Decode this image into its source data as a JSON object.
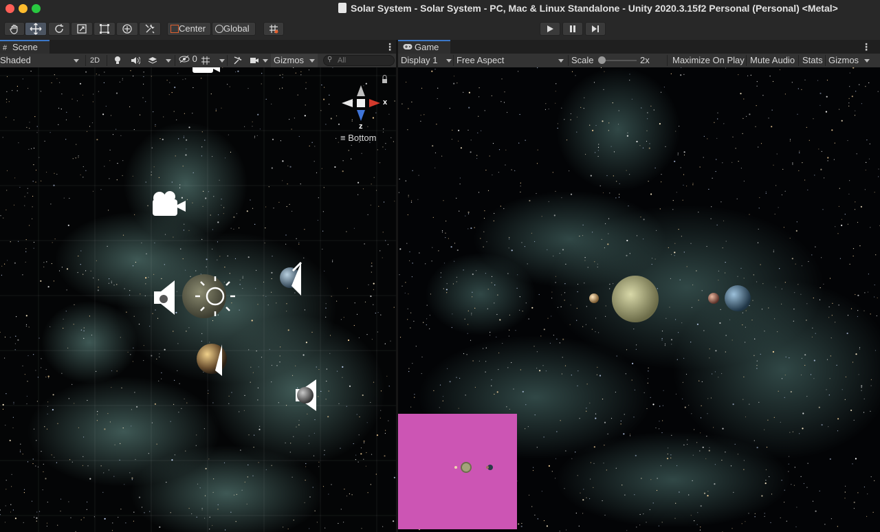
{
  "window": {
    "title": "Solar System - Solar System - PC, Mac & Linux Standalone - Unity 2020.3.15f2 Personal (Personal) <Metal>",
    "traffic_lights": {
      "close": "#ff5f57",
      "minimize": "#febc2e",
      "zoom": "#28c840"
    }
  },
  "toolbar": {
    "tools": [
      "hand-icon",
      "move-icon",
      "rotate-icon",
      "scale-icon",
      "rect-icon",
      "transform-icon",
      "custom-tool-icon"
    ],
    "pivot_mode": "Center",
    "pivot_rotation": "Global",
    "snap_icon": "grid-snap-icon",
    "play_controls": [
      "play-icon",
      "pause-icon",
      "step-icon"
    ]
  },
  "scene": {
    "tab_label": "Scene",
    "shading_mode": "Shaded",
    "mode_2d": "2D",
    "hidden_count": "0",
    "gizmos_label": "Gizmos",
    "search_placeholder": "All",
    "gizmo_axis_x": "x",
    "gizmo_axis_z": "z",
    "view_label": "Bottom"
  },
  "game": {
    "tab_label": "Game",
    "display": "Display 1",
    "aspect": "Free Aspect",
    "scale_label": "Scale",
    "scale_value": "2x",
    "maximize_label": "Maximize On Play",
    "mute_label": "Mute Audio",
    "stats_label": "Stats",
    "gizmos_label": "Gizmos",
    "minimap_color": "#cc55b4"
  },
  "colors": {
    "accent": "#3b78c9",
    "nebula": "#5f8f8a",
    "panel_bg": "#282828"
  }
}
